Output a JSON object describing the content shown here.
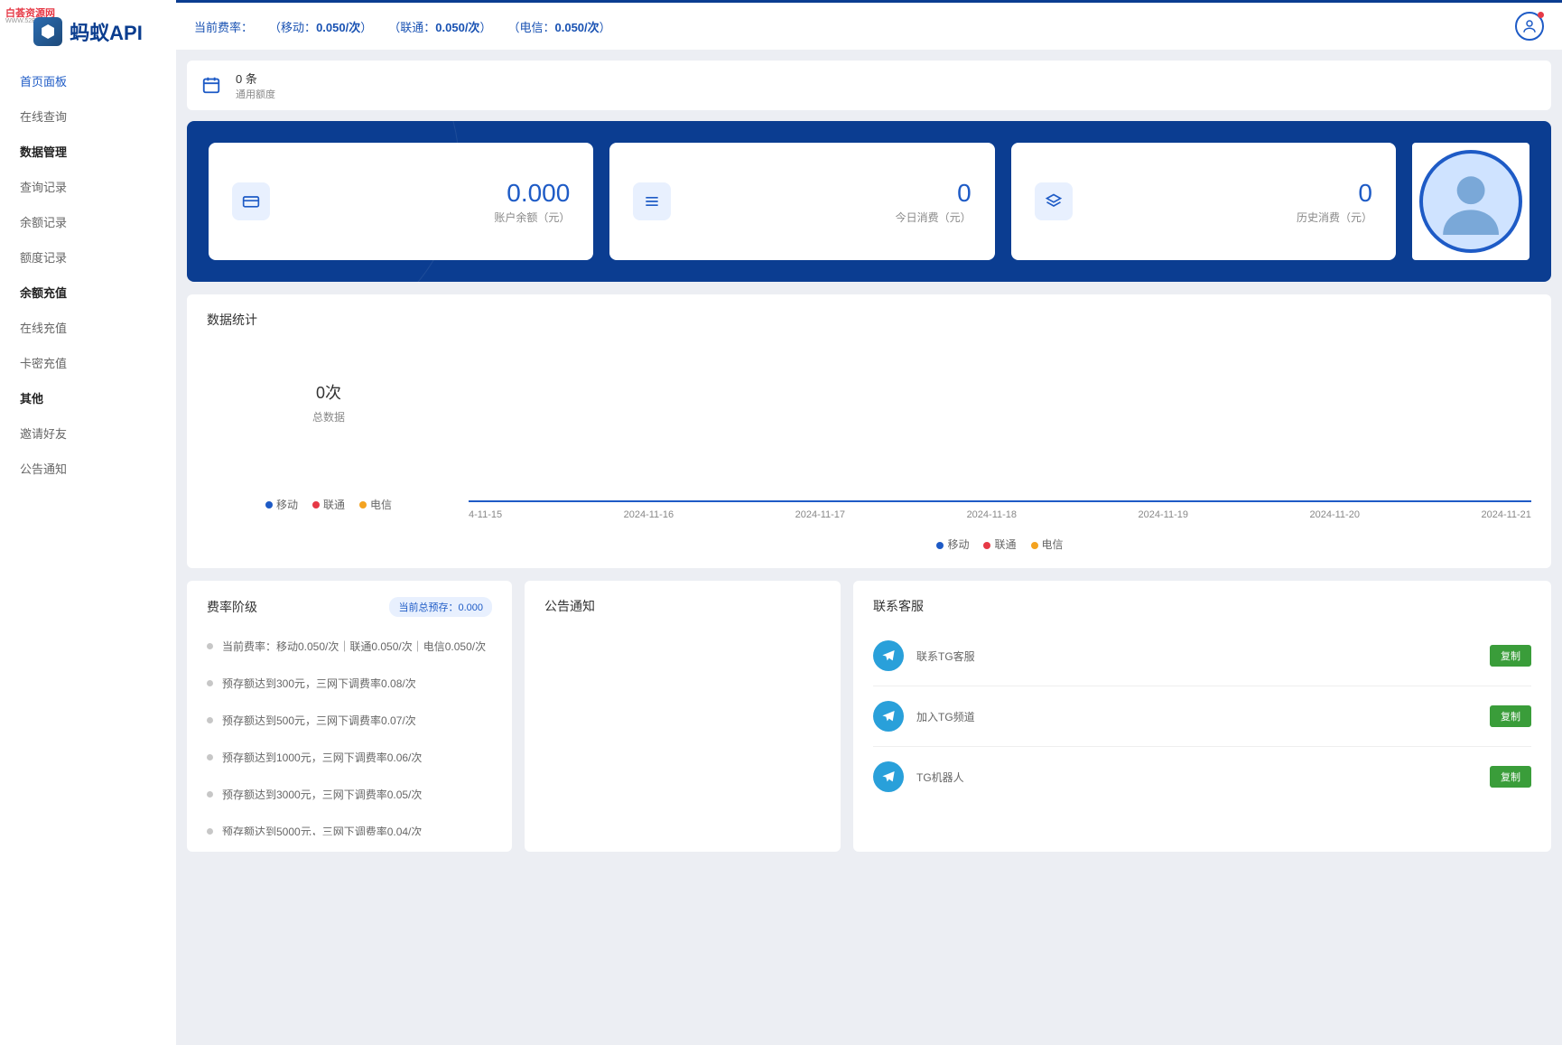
{
  "logo": "蚂蚁API",
  "watermark": {
    "line1": "白荟资源网",
    "line2": "WWW.52BYW.CN"
  },
  "topbar": {
    "rate_label": "当前费率：",
    "rates": [
      {
        "carrier": "移动",
        "value": "0.050/次"
      },
      {
        "carrier": "联通",
        "value": "0.050/次"
      },
      {
        "carrier": "电信",
        "value": "0.050/次"
      }
    ]
  },
  "sidebar": {
    "items": [
      {
        "label": "首页面板",
        "active": true
      },
      {
        "label": "在线查询"
      }
    ],
    "sections": [
      {
        "title": "数据管理",
        "items": [
          "查询记录",
          "余额记录",
          "额度记录"
        ]
      },
      {
        "title": "余额充值",
        "items": [
          "在线充值",
          "卡密充值"
        ]
      },
      {
        "title": "其他",
        "items": [
          "邀请好友",
          "公告通知"
        ]
      }
    ]
  },
  "quota": {
    "value": "0 条",
    "label": "通用额度"
  },
  "stats": [
    {
      "value": "0.000",
      "label": "账户余额（元）"
    },
    {
      "value": "0",
      "label": "今日消费（元）"
    },
    {
      "value": "0",
      "label": "历史消费（元）"
    }
  ],
  "chart": {
    "title": "数据统计",
    "total_value": "0次",
    "total_label": "总数据",
    "legend": [
      "移动",
      "联通",
      "电信"
    ]
  },
  "chart_data": {
    "type": "line",
    "categories": [
      "4-11-15",
      "2024-11-16",
      "2024-11-17",
      "2024-11-18",
      "2024-11-19",
      "2024-11-20",
      "2024-11-21"
    ],
    "series": [
      {
        "name": "移动",
        "values": [
          0,
          0,
          0,
          0,
          0,
          0,
          0
        ]
      },
      {
        "name": "联通",
        "values": [
          0,
          0,
          0,
          0,
          0,
          0,
          0
        ]
      },
      {
        "name": "电信",
        "values": [
          0,
          0,
          0,
          0,
          0,
          0,
          0
        ]
      }
    ],
    "ylim": [
      0,
      1
    ]
  },
  "tiers": {
    "title": "费率阶级",
    "badge_label": "当前总预存：",
    "badge_value": "0.000",
    "items": [
      "当前费率：移动0.050/次｜联通0.050/次｜电信0.050/次",
      "预存额达到300元，三网下调费率0.08/次",
      "预存额达到500元，三网下调费率0.07/次",
      "预存额达到1000元，三网下调费率0.06/次",
      "预存额达到3000元，三网下调费率0.05/次",
      "预存额达到5000元，三网下调费率0.04/次"
    ]
  },
  "notice": {
    "title": "公告通知"
  },
  "contact": {
    "title": "联系客服",
    "copy_label": "复制",
    "items": [
      "联系TG客服",
      "加入TG频道",
      "TG机器人"
    ]
  }
}
